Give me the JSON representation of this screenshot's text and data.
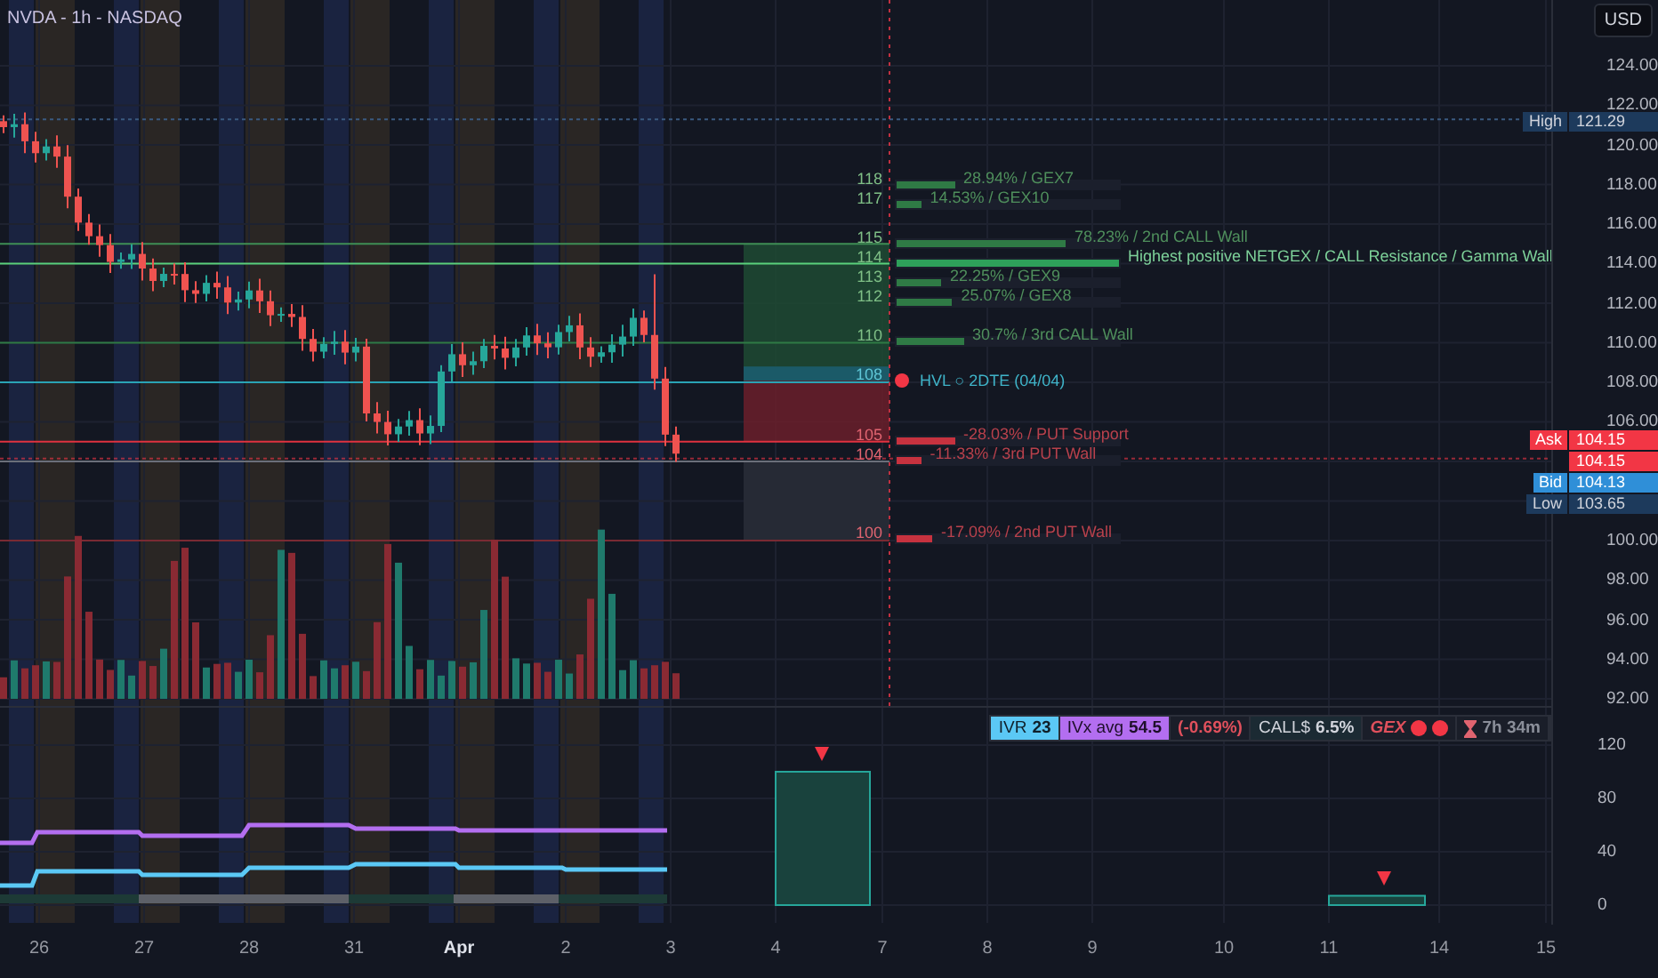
{
  "symbol_title": "NVDA - 1h - NASDAQ",
  "currency_button": "USD",
  "price_axis": {
    "ticks": [
      "124.00",
      "122.00",
      "120.00",
      "118.00",
      "116.00",
      "114.00",
      "112.00",
      "110.00",
      "108.00",
      "106.00",
      "100.00",
      "98.00",
      "96.00",
      "94.00",
      "92.00"
    ]
  },
  "price_tags": [
    {
      "kind": "high",
      "label": "High",
      "value": "121.29"
    },
    {
      "kind": "ask",
      "label": "Ask",
      "value": "104.15"
    },
    {
      "kind": "last",
      "value": "104.15"
    },
    {
      "kind": "bid",
      "label": "Bid",
      "value": "104.13"
    },
    {
      "kind": "low",
      "label": "Low",
      "value": "103.65"
    }
  ],
  "gex_levels": [
    {
      "strike": "118",
      "kind": "call",
      "level": 0.26,
      "label": "28.94% / GEX7"
    },
    {
      "strike": "117",
      "kind": "call",
      "level": 0.11,
      "label": "14.53% / GEX10"
    },
    {
      "strike": "115",
      "kind": "call",
      "level": 0.76,
      "label": "78.23% / 2nd CALL Wall"
    },
    {
      "strike": "114",
      "kind": "wall",
      "level": 1,
      "label": "Highest positive NETGEX / CALL Resistance / Gamma Wall"
    },
    {
      "strike": "113",
      "kind": "call",
      "level": 0.2,
      "label": "22.25% / GEX9"
    },
    {
      "strike": "112",
      "kind": "call",
      "level": 0.25,
      "label": "25.07% / GEX8"
    },
    {
      "strike": "110",
      "kind": "call",
      "level": 0.3,
      "label": "30.7% / 3rd CALL Wall"
    },
    {
      "strike": "108",
      "kind": "hvl",
      "label": "HVL ○ 2DTE (04/04)"
    },
    {
      "strike": "105",
      "kind": "put",
      "level": 0.26,
      "label": "-28.03% / PUT Support"
    },
    {
      "strike": "104",
      "kind": "put",
      "level": 0.11,
      "label": "-11.33% / 3rd PUT Wall"
    },
    {
      "strike": "100",
      "kind": "put",
      "level": 0.16,
      "label": "-17.09% / 2nd PUT Wall"
    }
  ],
  "info_strip": [
    {
      "kind": "ivr",
      "label": "IVR",
      "value": "23"
    },
    {
      "kind": "ivx",
      "label": "IVx avg",
      "value": "54.5"
    },
    {
      "kind": "change",
      "value": "(-0.69%)"
    },
    {
      "kind": "call",
      "label": "CALL$",
      "value": "6.5%"
    },
    {
      "kind": "gex",
      "label": "GEX"
    },
    {
      "kind": "timer",
      "value": "7h 34m"
    }
  ],
  "indicator_axis": {
    "ticks": [
      "120",
      "80",
      "40",
      "0"
    ]
  },
  "time_axis": [
    {
      "kind": "day",
      "label": "26"
    },
    {
      "kind": "day",
      "label": "27"
    },
    {
      "kind": "day",
      "label": "28"
    },
    {
      "kind": "day",
      "label": "31"
    },
    {
      "kind": "month",
      "label": "Apr"
    },
    {
      "kind": "day",
      "label": "2"
    },
    {
      "kind": "day",
      "label": "3"
    },
    {
      "kind": "day",
      "label": "4"
    },
    {
      "kind": "day",
      "label": "7"
    },
    {
      "kind": "day",
      "label": "8"
    },
    {
      "kind": "day",
      "label": "9"
    },
    {
      "kind": "day",
      "label": "10"
    },
    {
      "kind": "day",
      "label": "11"
    },
    {
      "kind": "day",
      "label": "14"
    },
    {
      "kind": "day",
      "label": "15"
    }
  ]
}
